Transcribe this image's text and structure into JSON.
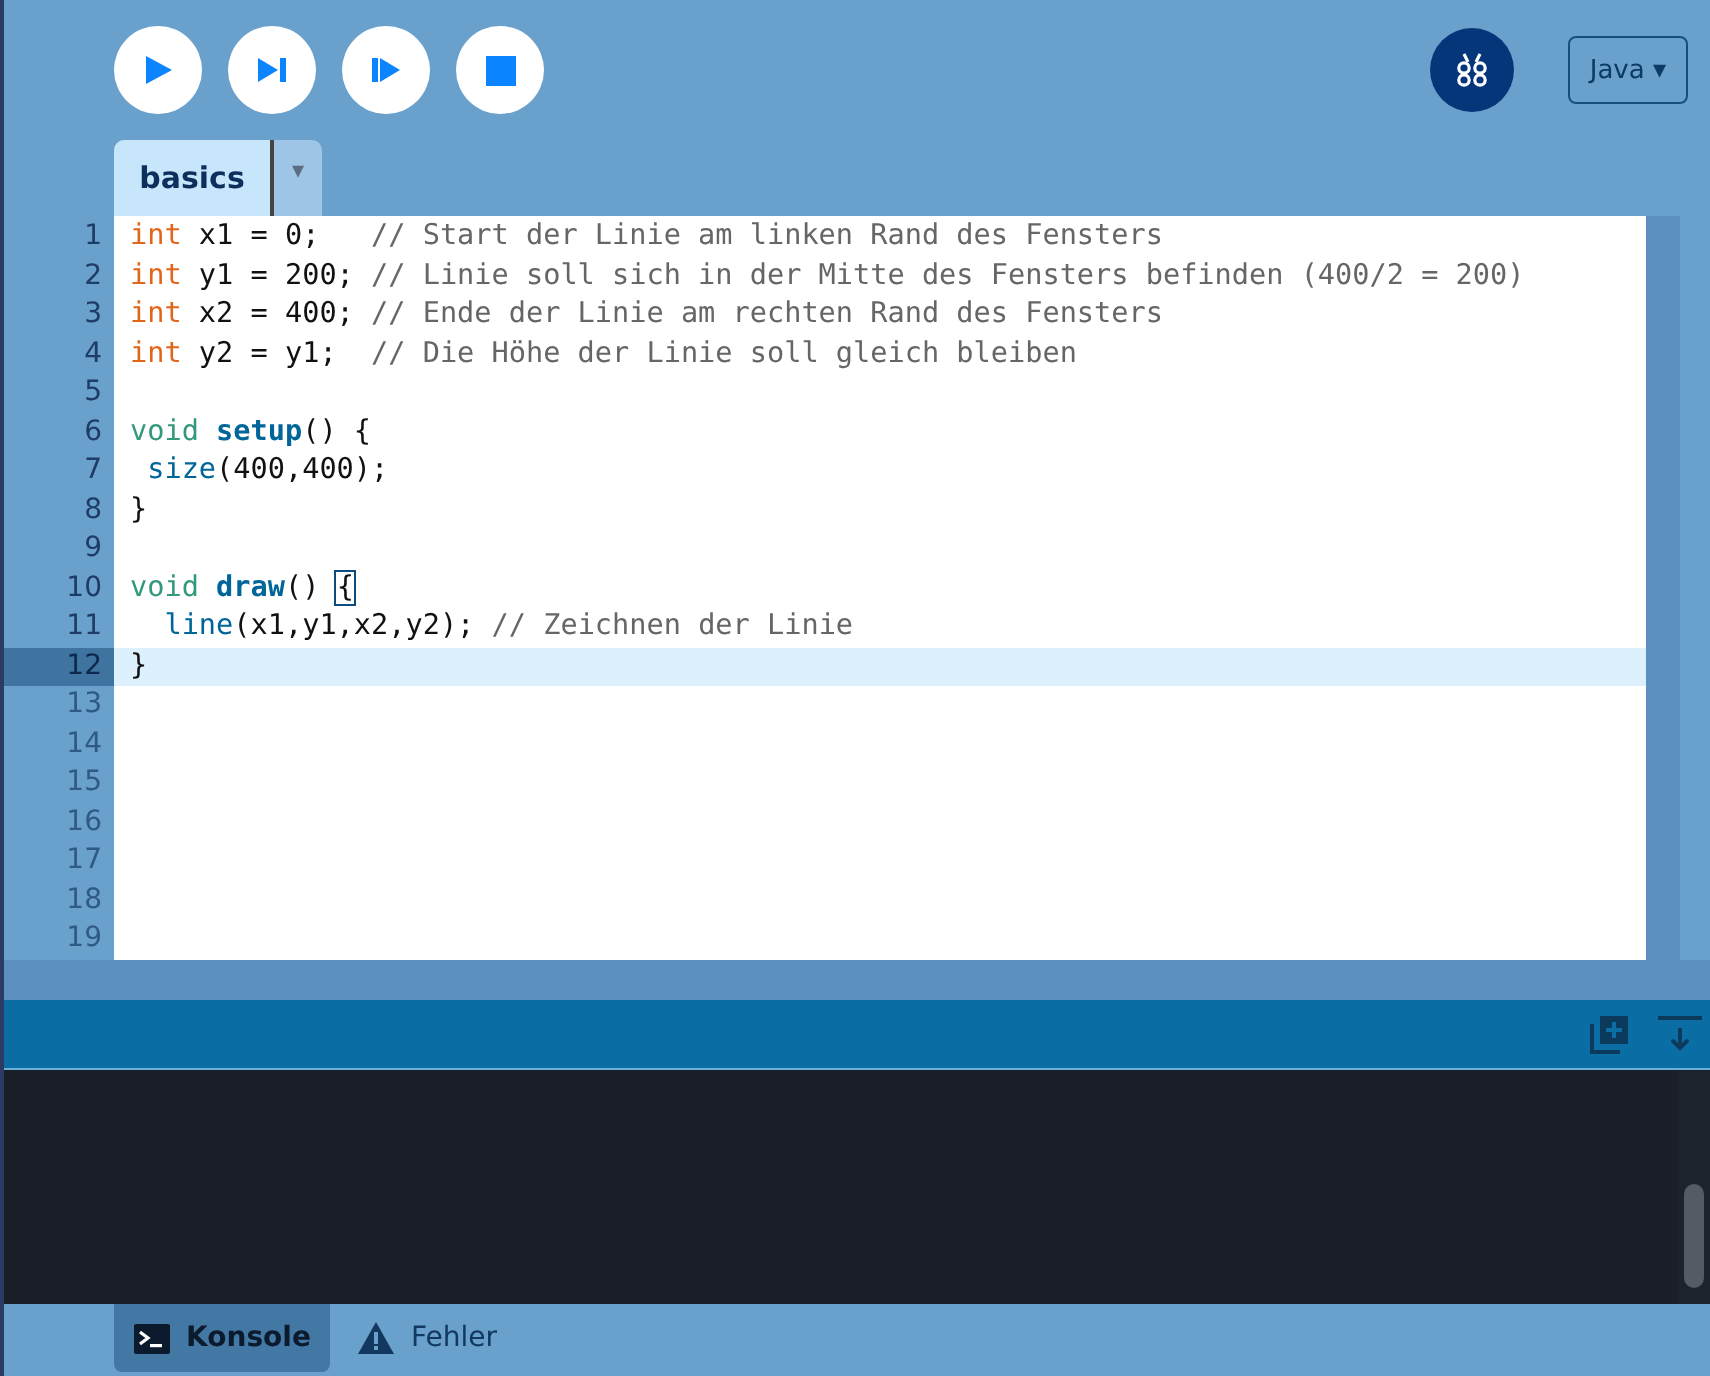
{
  "toolbar": {
    "buttons": [
      {
        "kind": "run"
      },
      {
        "kind": "step"
      },
      {
        "kind": "tweak"
      },
      {
        "kind": "stop"
      }
    ],
    "language": "Java ▾"
  },
  "tabs": [
    {
      "label": "basics",
      "selected": true
    }
  ],
  "tab_menu": "▾",
  "editor": {
    "lines": [
      {
        "number": "1",
        "current": false,
        "beyond_end": false,
        "segments": [
          {
            "kind": "keyword",
            "text": "int"
          },
          {
            "kind": "plain",
            "text": " x1 = 0;   "
          },
          {
            "kind": "comment",
            "text": "// Start der Linie am linken Rand des Fensters"
          }
        ]
      },
      {
        "number": "2",
        "current": false,
        "beyond_end": false,
        "segments": [
          {
            "kind": "keyword",
            "text": "int"
          },
          {
            "kind": "plain",
            "text": " y1 = 200; "
          },
          {
            "kind": "comment",
            "text": "// Linie soll sich in der Mitte des Fensters befinden (400/2 = 200)"
          }
        ]
      },
      {
        "number": "3",
        "current": false,
        "beyond_end": false,
        "segments": [
          {
            "kind": "keyword",
            "text": "int"
          },
          {
            "kind": "plain",
            "text": " x2 = 400; "
          },
          {
            "kind": "comment",
            "text": "// Ende der Linie am rechten Rand des Fensters"
          }
        ]
      },
      {
        "number": "4",
        "current": false,
        "beyond_end": false,
        "segments": [
          {
            "kind": "keyword",
            "text": "int"
          },
          {
            "kind": "plain",
            "text": " y2 = y1;  "
          },
          {
            "kind": "comment",
            "text": "// Die Höhe der Linie soll gleich bleiben"
          }
        ]
      },
      {
        "number": "5",
        "current": false,
        "beyond_end": false
      },
      {
        "number": "6",
        "current": false,
        "beyond_end": false,
        "segments": [
          {
            "kind": "type",
            "text": "void "
          },
          {
            "kind": "function",
            "text": "setup"
          },
          {
            "kind": "plain",
            "text": "() {"
          }
        ]
      },
      {
        "number": "7",
        "current": false,
        "beyond_end": false,
        "segments": [
          {
            "kind": "builtin",
            "text": " size"
          },
          {
            "kind": "plain",
            "text": "(400,400);"
          }
        ]
      },
      {
        "number": "8",
        "current": false,
        "beyond_end": false,
        "segments": [
          {
            "kind": "plain",
            "text": "}"
          }
        ]
      },
      {
        "number": "9",
        "current": false,
        "beyond_end": false
      },
      {
        "number": "10",
        "current": false,
        "beyond_end": false,
        "segments": [
          {
            "kind": "type",
            "text": "void "
          },
          {
            "kind": "function",
            "text": "draw"
          },
          {
            "kind": "plain",
            "text": "() "
          },
          {
            "kind": "matched_bracket",
            "text": "{"
          }
        ]
      },
      {
        "number": "11",
        "current": false,
        "beyond_end": false,
        "segments": [
          {
            "kind": "builtin",
            "text": "  line"
          },
          {
            "kind": "plain",
            "text": "(x1,y1,x2,y2); "
          },
          {
            "kind": "comment",
            "text": "// Zeichnen der Linie"
          }
        ]
      },
      {
        "number": "12",
        "current": true,
        "beyond_end": false,
        "segments": [
          {
            "kind": "plain",
            "text": "}"
          }
        ]
      },
      {
        "number": "13",
        "current": false,
        "beyond_end": true
      },
      {
        "number": "14",
        "current": false,
        "beyond_end": true
      },
      {
        "number": "15",
        "current": false,
        "beyond_end": true
      },
      {
        "number": "16",
        "current": false,
        "beyond_end": true
      },
      {
        "number": "17",
        "current": false,
        "beyond_end": true
      },
      {
        "number": "18",
        "current": false,
        "beyond_end": true
      },
      {
        "number": "19",
        "current": false,
        "beyond_end": true
      }
    ]
  },
  "console": {
    "tabs": [
      {
        "label": "Konsole",
        "kind": "console",
        "selected": true
      },
      {
        "label": "Fehler",
        "kind": "errors",
        "selected": false
      }
    ]
  }
}
